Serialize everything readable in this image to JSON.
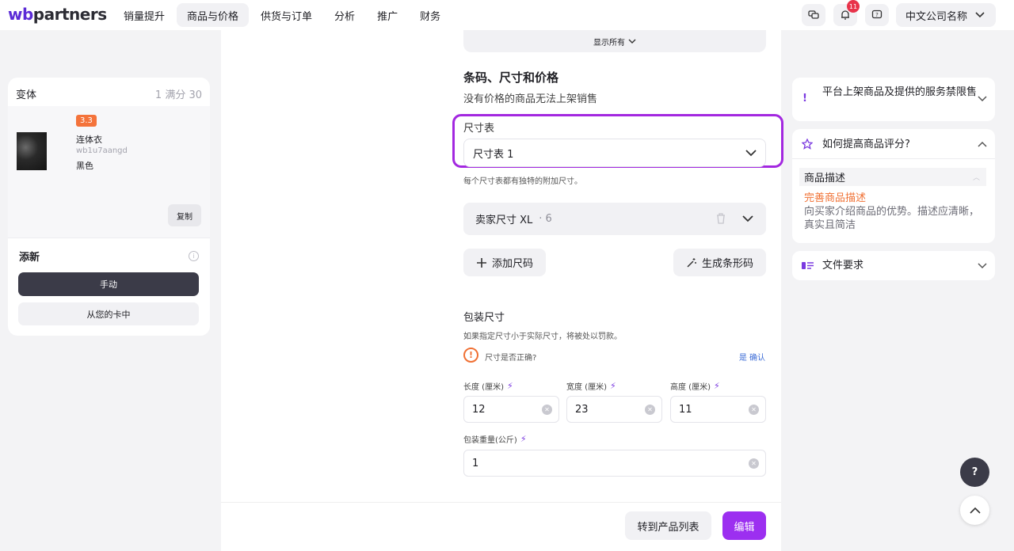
{
  "logo": "wbpartners",
  "nav": [
    "销量提升",
    "商品与价格",
    "供货与订单",
    "分析",
    "推广",
    "财务"
  ],
  "notifications_count": "11",
  "company_name": "中文公司名称",
  "left": {
    "variant_title": "变体",
    "variant_count": "1 满分 30",
    "rating": "3.3",
    "product_name": "连体衣",
    "sku": "wb1u7aangd",
    "color": "黑色",
    "copy": "复制",
    "add_title": "添新",
    "manual": "手动",
    "from_card": "从您的卡中"
  },
  "middle": {
    "show_all": "显示所有",
    "section_title": "条码、尺寸和价格",
    "section_subtitle": "没有价格的商品无法上架销售",
    "size_table_label": "尺寸表",
    "size_table_value": "尺寸表 1",
    "size_hint": "每个尺寸表都有独特的附加尺寸。",
    "seller_size": "卖家尺寸 XL",
    "seller_size_count": "· 6",
    "add_size": "添加尺码",
    "generate_barcode": "生成条形码",
    "pack_title": "包装尺寸",
    "pack_hint": "如果指定尺寸小于实际尺寸，将被处以罚款。",
    "warn_text": "尺寸是否正确?",
    "confirm": "是 确认",
    "length_label": "长度 (厘米)",
    "width_label": "宽度 (厘米)",
    "height_label": "高度 (厘米)",
    "length": "12",
    "width": "23",
    "height": "11",
    "weight_label": "包装重量(公斤)",
    "weight": "1"
  },
  "footer": {
    "goto_list": "转到产品列表",
    "edit": "编辑"
  },
  "right": {
    "ban_title": "平台上架商品及提供的服务禁限售",
    "rating_title": "如何提高商品评分?",
    "desc_row": "商品描述",
    "desc_link": "完善商品描述",
    "desc_text": "向买家介绍商品的优势。描述应清晰，真实且简洁",
    "file_req": "文件要求"
  },
  "help": "?"
}
